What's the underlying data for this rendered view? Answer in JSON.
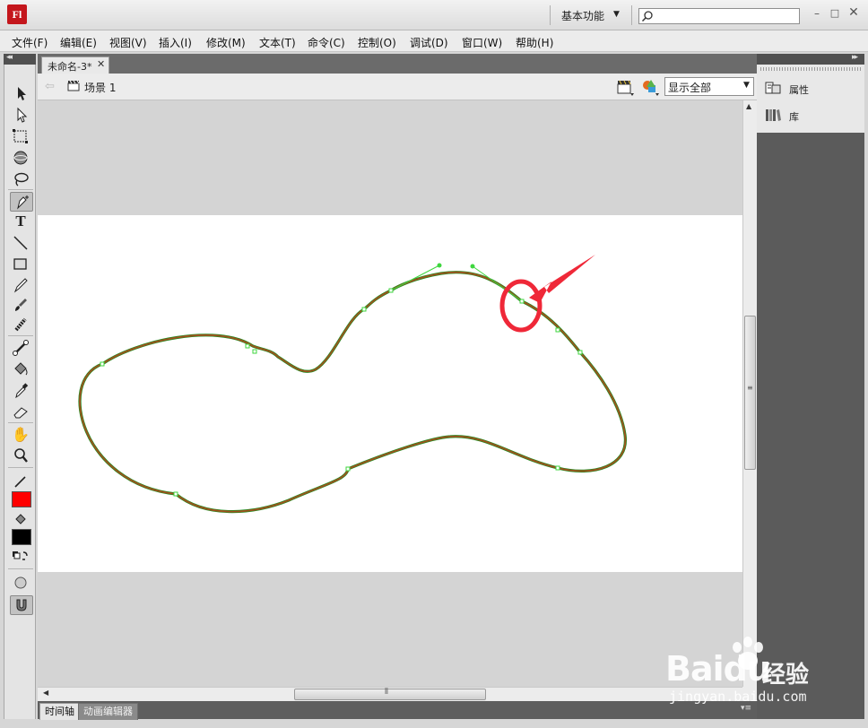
{
  "app": {
    "logo": "Fl",
    "workspace": "基本功能",
    "search_placeholder": ""
  },
  "menu": [
    "文件(F)",
    "编辑(E)",
    "视图(V)",
    "插入(I)",
    "修改(M)",
    "文本(T)",
    "命令(C)",
    "控制(O)",
    "调试(D)",
    "窗口(W)",
    "帮助(H)"
  ],
  "document": {
    "tab_title": "未命名-3*",
    "scene": "场景 1",
    "zoom": "显示全部"
  },
  "bottom_tabs": [
    "时间轴",
    "动画编辑器"
  ],
  "right_panel": {
    "items": [
      {
        "label": "属性",
        "icon": "properties-icon"
      },
      {
        "label": "库",
        "icon": "library-icon"
      }
    ]
  },
  "tools": [
    "selection-tool",
    "subselection-tool",
    "free-transform-tool",
    "3d-rotation-tool",
    "lasso-tool",
    "pen-tool",
    "text-tool",
    "line-tool",
    "rectangle-tool",
    "pencil-tool",
    "brush-tool",
    "deco-tool",
    "bone-tool",
    "paint-bucket-tool",
    "eyedropper-tool",
    "eraser-tool",
    "hand-tool",
    "zoom-tool"
  ],
  "colors": {
    "stroke_color": "#ff0000",
    "fill_color": "#000000",
    "curve_stroke": "#a0521e",
    "anchor_color": "#2ee82e",
    "annotation": "#f0253a"
  },
  "watermark": {
    "brand": "Baidu",
    "cn": "经验",
    "url": "jingyan.baidu.com"
  }
}
